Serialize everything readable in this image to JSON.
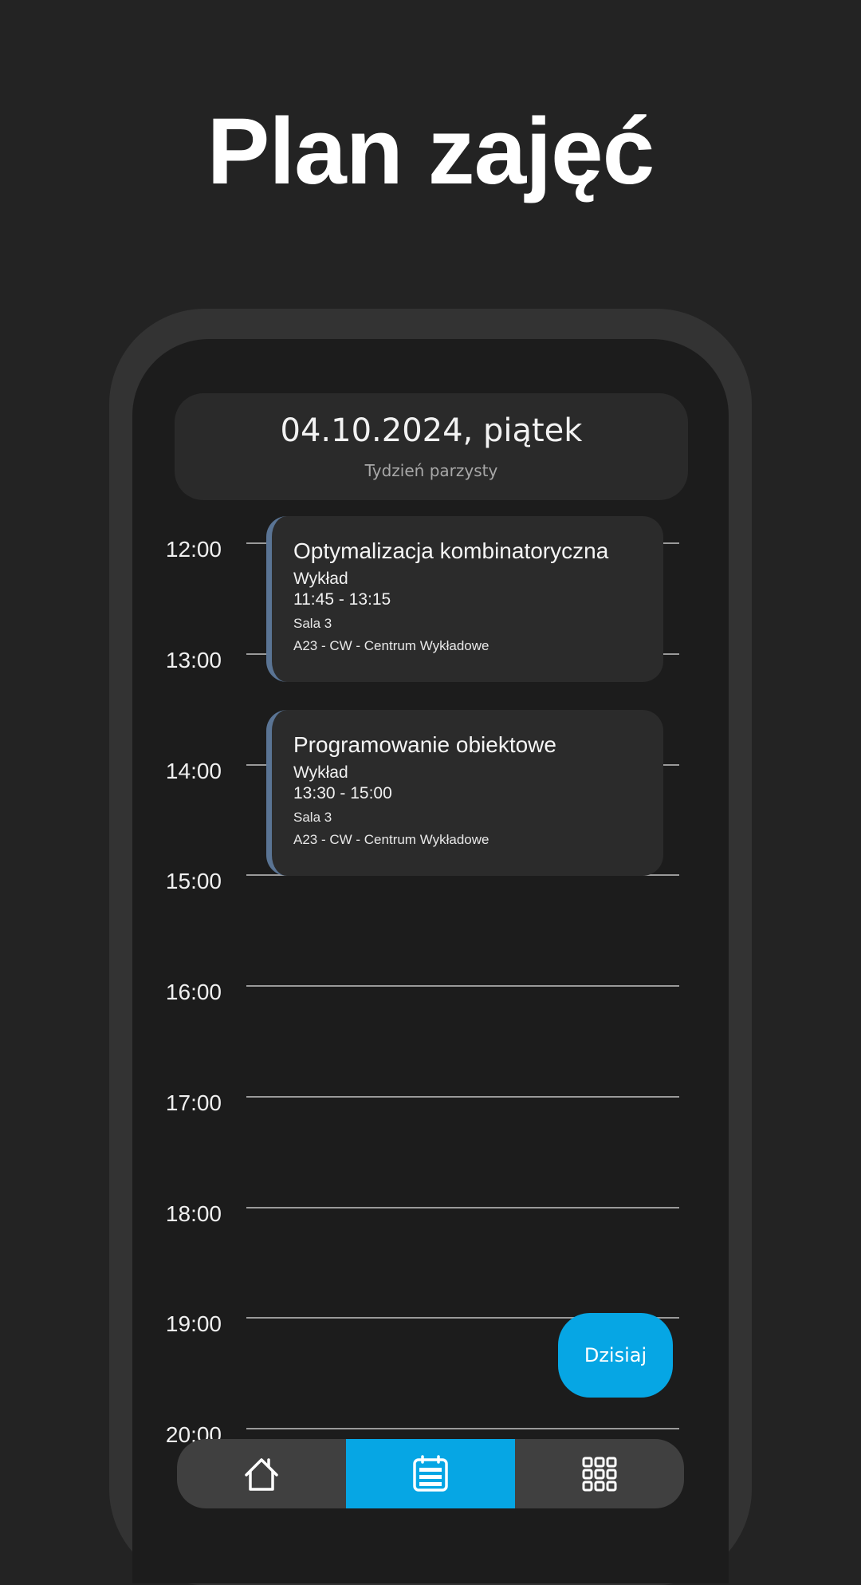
{
  "page": {
    "title": "Plan zajęć"
  },
  "header": {
    "date": "04.10.2024, piątek",
    "week": "Tydzień parzysty"
  },
  "hours": [
    "12:00",
    "13:00",
    "14:00",
    "15:00",
    "16:00",
    "17:00",
    "18:00",
    "19:00",
    "20:00"
  ],
  "events": [
    {
      "title": "Optymalizacja kombinatoryczna",
      "type": "Wykład",
      "time": "11:45 - 13:15",
      "room": "Sala 3",
      "building": "A23 - CW - Centrum Wykładowe"
    },
    {
      "title": "Programowanie obiektowe",
      "type": "Wykład",
      "time": "13:30 - 15:00",
      "room": "Sala 3",
      "building": "A23 - CW - Centrum Wykładowe"
    }
  ],
  "today_button": {
    "label": "Dzisiaj"
  },
  "nav": {
    "items": [
      {
        "icon": "home-icon",
        "active": false
      },
      {
        "icon": "calendar-icon",
        "active": true
      },
      {
        "icon": "grid-icon",
        "active": false
      }
    ]
  },
  "colors": {
    "background": "#232323",
    "screen": "#1c1c1c",
    "accent": "#06a6e4",
    "card": "#2b2b2b",
    "event_stripe": "#5a7494"
  }
}
